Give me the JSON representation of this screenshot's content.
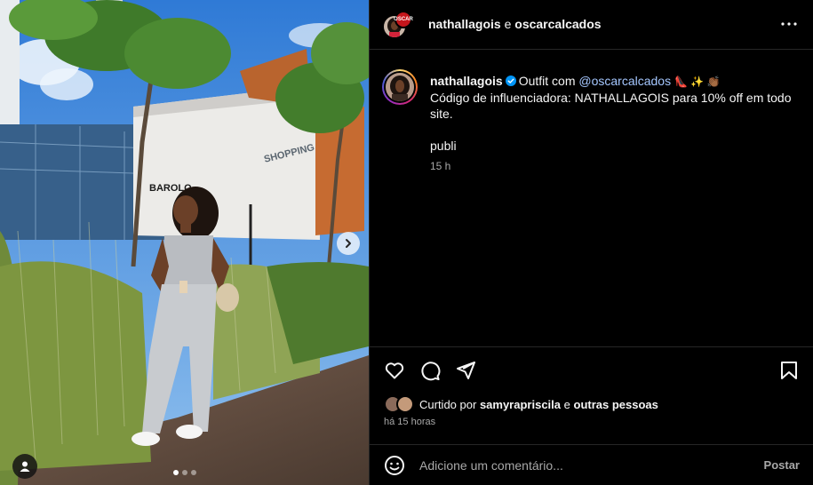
{
  "colors": {
    "background": "#000000",
    "divider": "#262626",
    "muted": "#a8a8a8",
    "mention": "#a5c7ff",
    "verified": "#0095f6"
  },
  "media": {
    "sign_shopping": "SHOPPING",
    "sign_store": "BAROLO",
    "carousel_count": 3,
    "carousel_active": 1
  },
  "header": {
    "author": "nathallagois",
    "connector": "e",
    "collaborator": "oscarcalcados",
    "brand_avatar_text": "OSCAR",
    "more_icon": "more-horizontal-icon"
  },
  "caption": {
    "username": "nathallagois",
    "text_before": "Outfit com",
    "mention": "@oscarcalcados",
    "emojis": "👠 ✨ 👏🏾",
    "line2": "Código de influenciadora: NATHALLAGOIS para 10% off em todo site.",
    "line3": "publi",
    "time": "15 h"
  },
  "actions": {
    "like_icon": "heart-icon",
    "comment_icon": "comment-icon",
    "share_icon": "share-icon",
    "save_icon": "bookmark-icon"
  },
  "likes": {
    "prefix": "Curtido por",
    "user": "samyrapriscila",
    "connector": "e",
    "others": "outras pessoas"
  },
  "timestamp": "há 15 horas",
  "comment": {
    "placeholder": "Adicione um comentário...",
    "post_label": "Postar"
  }
}
